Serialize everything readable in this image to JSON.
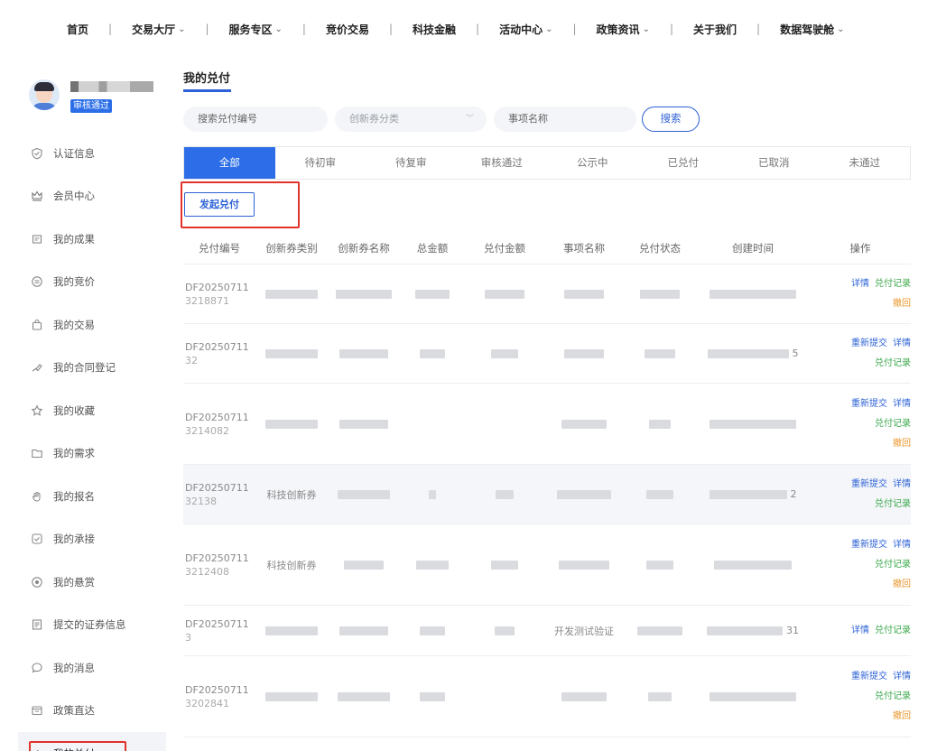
{
  "nav": {
    "items": [
      {
        "label": "首页",
        "dropdown": false
      },
      {
        "label": "交易大厅",
        "dropdown": true
      },
      {
        "label": "服务专区",
        "dropdown": true
      },
      {
        "label": "竞价交易",
        "dropdown": false
      },
      {
        "label": "科技金融",
        "dropdown": false
      },
      {
        "label": "活动中心",
        "dropdown": true
      },
      {
        "label": "政策资讯",
        "dropdown": true
      },
      {
        "label": "关于我们",
        "dropdown": false
      },
      {
        "label": "数据驾驶舱",
        "dropdown": true
      }
    ],
    "separator": "|",
    "chevron": "⌄"
  },
  "profile": {
    "status_badge": "审核通过"
  },
  "sidebar": {
    "items": [
      {
        "label": "认证信息",
        "icon": "shield-check-icon"
      },
      {
        "label": "会员中心",
        "icon": "crown-icon"
      },
      {
        "label": "我的成果",
        "icon": "trophy-icon"
      },
      {
        "label": "我的竞价",
        "icon": "auction-icon"
      },
      {
        "label": "我的交易",
        "icon": "bag-icon"
      },
      {
        "label": "我的合同登记",
        "icon": "contract-icon"
      },
      {
        "label": "我的收藏",
        "icon": "star-icon"
      },
      {
        "label": "我的需求",
        "icon": "folder-icon"
      },
      {
        "label": "我的报名",
        "icon": "hand-icon"
      },
      {
        "label": "我的承接",
        "icon": "check-box-icon"
      },
      {
        "label": "我的悬赏",
        "icon": "target-icon"
      },
      {
        "label": "提交的证券信息",
        "icon": "document-icon"
      },
      {
        "label": "我的消息",
        "icon": "chat-icon"
      },
      {
        "label": "政策直达",
        "icon": "policy-icon"
      },
      {
        "label": "我的兑付",
        "icon": "payment-icon",
        "active": true
      }
    ]
  },
  "main": {
    "title": "我的兑付",
    "filters": {
      "code_placeholder": "搜索兑付编号",
      "category_placeholder": "创新券分类",
      "item_placeholder": "事项名称",
      "search_label": "搜索"
    },
    "tabs": [
      {
        "label": "全部",
        "active": true
      },
      {
        "label": "待初审"
      },
      {
        "label": "待复审"
      },
      {
        "label": "审核通过"
      },
      {
        "label": "公示中"
      },
      {
        "label": "已兑付"
      },
      {
        "label": "已取消"
      },
      {
        "label": "未通过"
      }
    ],
    "issue_button": "发起兑付",
    "table": {
      "headers": [
        "兑付编号",
        "创新券类别",
        "创新券名称",
        "总金额",
        "兑付金额",
        "事项名称",
        "兑付状态",
        "创建时间",
        "操作"
      ],
      "rows": [
        {
          "code1": "DF20250711",
          "code2": "3218871",
          "type": "",
          "ops": [
            [
              "详情",
              "兑付记录"
            ],
            [
              "撤回"
            ]
          ]
        },
        {
          "code1": "DF20250711",
          "code2": "32",
          "type": "",
          "time_tail": "5",
          "ops": [
            [
              "重新提交",
              "详情"
            ],
            [
              "兑付记录"
            ]
          ]
        },
        {
          "code1": "DF20250711",
          "code2": "3214082",
          "type": "",
          "ops": [
            [
              "重新提交",
              "详情"
            ],
            [
              "兑付记录"
            ],
            [
              "撤回"
            ]
          ]
        },
        {
          "code1": "DF20250711",
          "code2": "32138",
          "type": "科技创新券",
          "time_tail": "2",
          "ops": [
            [
              "重新提交",
              "详情"
            ],
            [
              "兑付记录"
            ]
          ]
        },
        {
          "code1": "DF20250711",
          "code2": "3212408",
          "type": "科技创新券",
          "ops": [
            [
              "重新提交",
              "详情"
            ],
            [
              "兑付记录"
            ],
            [
              "撤回"
            ]
          ]
        },
        {
          "code1": "DF20250711",
          "code2": "3",
          "type": "",
          "item": "开发测试验证",
          "time_tail": "31",
          "ops": [
            [
              "详情",
              "兑付记录"
            ]
          ]
        },
        {
          "code1": "DF20250711",
          "code2": "3202841",
          "type": "",
          "ops": [
            [
              "重新提交",
              "详情"
            ],
            [
              "兑付记录"
            ],
            [
              "撤回"
            ]
          ]
        }
      ]
    }
  },
  "colors": {
    "accent": "#2d6ee8",
    "highlight_box": "#e0332b",
    "op_blue": "#2d62d6",
    "op_green": "#3aa84a",
    "op_orange": "#e8962a"
  }
}
